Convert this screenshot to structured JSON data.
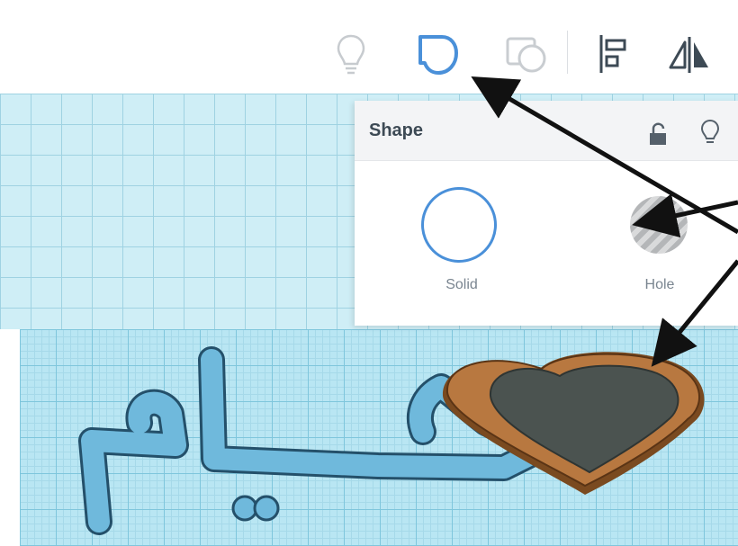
{
  "toolbar": {
    "tools": [
      {
        "name": "bulb-icon",
        "active": false
      },
      {
        "name": "shape-icon",
        "active": true
      },
      {
        "name": "group-icon",
        "active": false
      },
      {
        "name": "align-icon",
        "active": false
      },
      {
        "name": "mirror-icon",
        "active": false
      }
    ]
  },
  "shape_panel": {
    "title": "Shape",
    "lock_icon": "lock-icon",
    "bulb_icon": "bulb-icon",
    "options": {
      "solid_label": "Solid",
      "hole_label": "Hole"
    }
  },
  "scene": {
    "text_model_color": "#6fb9dc",
    "heart_outer_color": "#b87840",
    "heart_inner_color": "#4b5350",
    "accent": "#4a90d9"
  }
}
